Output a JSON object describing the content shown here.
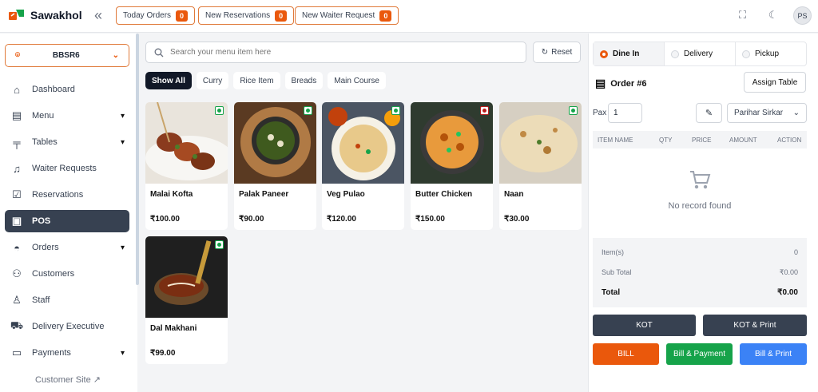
{
  "app": {
    "name": "Sawakhol"
  },
  "header": {
    "today_orders": {
      "label": "Today Orders",
      "count": "0"
    },
    "new_reservations": {
      "label": "New Reservations",
      "count": "0"
    },
    "new_waiter_request": {
      "label": "New Waiter Request",
      "count": "0"
    },
    "avatar_initials": "PS"
  },
  "sidebar": {
    "location": "BBSR6",
    "items": [
      {
        "label": "Dashboard",
        "icon": "home-icon"
      },
      {
        "label": "Menu",
        "icon": "menu-book-icon"
      },
      {
        "label": "Tables",
        "icon": "table-icon"
      },
      {
        "label": "Waiter Requests",
        "icon": "bell-icon"
      },
      {
        "label": "Reservations",
        "icon": "calendar-check-icon"
      },
      {
        "label": "POS",
        "icon": "pos-icon"
      },
      {
        "label": "Orders",
        "icon": "cloche-icon"
      },
      {
        "label": "Customers",
        "icon": "users-icon"
      },
      {
        "label": "Staff",
        "icon": "staff-icon"
      },
      {
        "label": "Delivery Executive",
        "icon": "scooter-icon"
      },
      {
        "label": "Payments",
        "icon": "wallet-icon"
      }
    ],
    "customer_site": "Customer Site"
  },
  "search": {
    "placeholder": "Search your menu item here",
    "reset_label": "Reset"
  },
  "categories": [
    "Show All",
    "Curry",
    "Rice Item",
    "Breads",
    "Main Course"
  ],
  "menu_items": [
    {
      "name": "Malai Kofta",
      "price": "₹100.00"
    },
    {
      "name": "Palak Paneer",
      "price": "₹90.00"
    },
    {
      "name": "Veg Pulao",
      "price": "₹120.00"
    },
    {
      "name": "Butter Chicken",
      "price": "₹150.00"
    },
    {
      "name": "Naan",
      "price": "₹30.00"
    },
    {
      "name": "Dal Makhani",
      "price": "₹99.00"
    }
  ],
  "order": {
    "types": [
      "Dine In",
      "Delivery",
      "Pickup"
    ],
    "title": "Order #6",
    "assign_table": "Assign Table",
    "pax_label": "Pax",
    "pax_value": "1",
    "waiter": "Parihar Sirkar",
    "columns": [
      "ITEM NAME",
      "QTY",
      "PRICE",
      "AMOUNT",
      "ACTION"
    ],
    "empty_text": "No record found",
    "items_label": "Item(s)",
    "items_value": "0",
    "subtotal_label": "Sub Total",
    "subtotal_value": "₹0.00",
    "total_label": "Total",
    "total_value": "₹0.00",
    "buttons": {
      "kot": "KOT",
      "kot_print": "KOT & Print",
      "bill": "BILL",
      "bill_payment": "Bill & Payment",
      "bill_print": "Bill & Print"
    }
  },
  "colors": {
    "accent": "#ea580c",
    "dark": "#374151",
    "green": "#16a34a",
    "blue": "#3b82f6"
  }
}
